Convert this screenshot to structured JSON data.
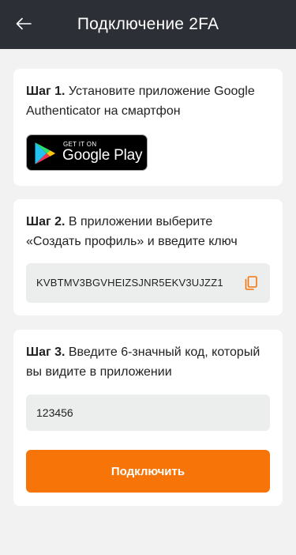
{
  "header": {
    "title": "Подключение 2FA",
    "back_icon": "arrow-left-icon",
    "background": "#2c2f35"
  },
  "step1": {
    "label": "Шаг 1.",
    "text": " Установите приложение Google Authenticator на смартфон",
    "badge": {
      "small": "GET IT ON",
      "big": "Google Play",
      "icon": "google-play-icon"
    }
  },
  "step2": {
    "label": "Шаг 2.",
    "text": " В приложении выберите «Создать профиль» и введите ключ",
    "key": "KVBTMV3BGVHEIZSJNR5EKV3UJZZ1",
    "copy_icon": "copy-icon"
  },
  "step3": {
    "label": "Шаг 3.",
    "text": " Введите 6-значный код, который вы видите в приложении",
    "code_value": "123456",
    "button_label": "Подключить"
  },
  "colors": {
    "accent": "#f77508",
    "page_bg": "#f2f2f2",
    "field_bg": "#eceded"
  }
}
